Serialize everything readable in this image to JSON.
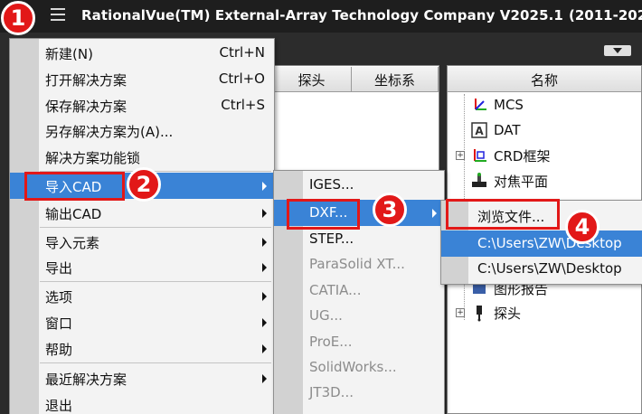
{
  "titlebar": {
    "title": "RationalVue(TM) External-Array Technology Company V2025.1",
    "years": "(2011-202"
  },
  "left_panel": {
    "col1": "探头",
    "col2": "坐标系"
  },
  "right_panel": {
    "header": "名称",
    "tree": [
      {
        "label": "MCS",
        "icon": "coordinate-axes-icon"
      },
      {
        "label": "DAT",
        "icon": "datum-a-icon"
      },
      {
        "label": "CRD框架",
        "icon": "frame-axes-icon",
        "expander": "+"
      },
      {
        "label": "对焦平面",
        "icon": "focus-plane-icon"
      },
      {
        "label": "图形报告",
        "icon": "report-icon"
      },
      {
        "label": "探头",
        "icon": "probe-icon",
        "expander": "+"
      }
    ]
  },
  "main_menu": {
    "items": [
      {
        "label": "新建(N)",
        "shortcut": "Ctrl+N"
      },
      {
        "label": "打开解决方案",
        "shortcut": "Ctrl+O"
      },
      {
        "label": "保存解决方案",
        "shortcut": "Ctrl+S"
      },
      {
        "label": "另存解决方案为(A)...",
        "shortcut": ""
      },
      {
        "label": "解决方案功能锁",
        "shortcut": ""
      },
      {
        "label": "导入CAD",
        "shortcut": ""
      },
      {
        "label": "输出CAD",
        "shortcut": ""
      },
      {
        "label": "导入元素",
        "shortcut": ""
      },
      {
        "label": "导出",
        "shortcut": ""
      },
      {
        "label": "选项",
        "shortcut": ""
      },
      {
        "label": "窗口",
        "shortcut": ""
      },
      {
        "label": "帮助",
        "shortcut": ""
      },
      {
        "label": "最近解决方案",
        "shortcut": ""
      },
      {
        "label": "退出",
        "shortcut": ""
      }
    ]
  },
  "cad_menu": {
    "items": [
      "IGES...",
      "DXF...",
      "STEP...",
      "ParaSolid XT...",
      "CATIA...",
      "UG...",
      "ProE...",
      "SolidWorks...",
      "JT3D..."
    ]
  },
  "dxf_menu": {
    "items": [
      "浏览文件...",
      "C:\\Users\\ZW\\Desktop",
      "C:\\Users\\ZW\\Desktop"
    ]
  },
  "steps": [
    "1",
    "2",
    "3",
    "4"
  ],
  "colors": {
    "highlight": "#3a83d6",
    "annotation": "#e21818",
    "titlebar": "#1e1e1e"
  }
}
